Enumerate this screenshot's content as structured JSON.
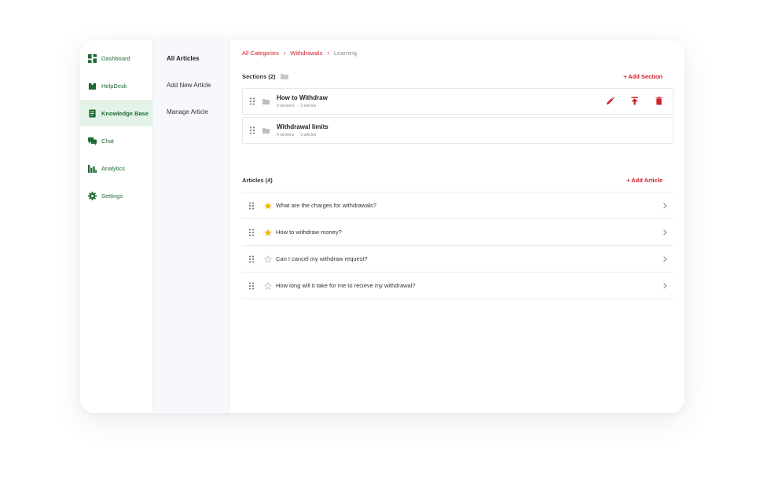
{
  "nav": {
    "items": [
      {
        "label": "Dashboard",
        "icon": "dashboard-icon"
      },
      {
        "label": "HelpDesk",
        "icon": "helpdesk-icon"
      },
      {
        "label": "Knowledge Base",
        "icon": "knowledge-base-icon",
        "active": true
      },
      {
        "label": "Chat",
        "icon": "chat-icon"
      },
      {
        "label": "Analytics",
        "icon": "analytics-icon"
      },
      {
        "label": "Settings",
        "icon": "gear-icon"
      }
    ]
  },
  "subnav": {
    "items": [
      {
        "label": "All Articles",
        "active": true
      },
      {
        "label": "Add New Article"
      },
      {
        "label": "Manage Article"
      }
    ]
  },
  "breadcrumb": {
    "items": [
      "All Categories",
      "Withdrawals",
      "Learning"
    ]
  },
  "sections": {
    "title": "Sections (2)",
    "add_label": "+ Add Section",
    "rows": [
      {
        "name": "How to Withdraw",
        "sections": "0 sections",
        "articles": "2 articles"
      },
      {
        "name": "Withdrawal limits",
        "sections": "0 sections",
        "articles": "3 articles"
      }
    ]
  },
  "articles": {
    "title": "Articles (4)",
    "add_label": "+ Add Article",
    "rows": [
      {
        "title": "What are the charges for withdrawals?",
        "starred": true
      },
      {
        "title": "How to withdraw money?",
        "starred": true
      },
      {
        "title": "Can I cancel my withdraw request?",
        "starred": false
      },
      {
        "title": "How long will it take for me to recieve my withdrawal?",
        "starred": false
      }
    ]
  },
  "colors": {
    "accent_red": "#d0202a",
    "nav_green": "#1f6b35",
    "active_bg": "#e4f3e7",
    "star_yellow": "#f5b301"
  }
}
